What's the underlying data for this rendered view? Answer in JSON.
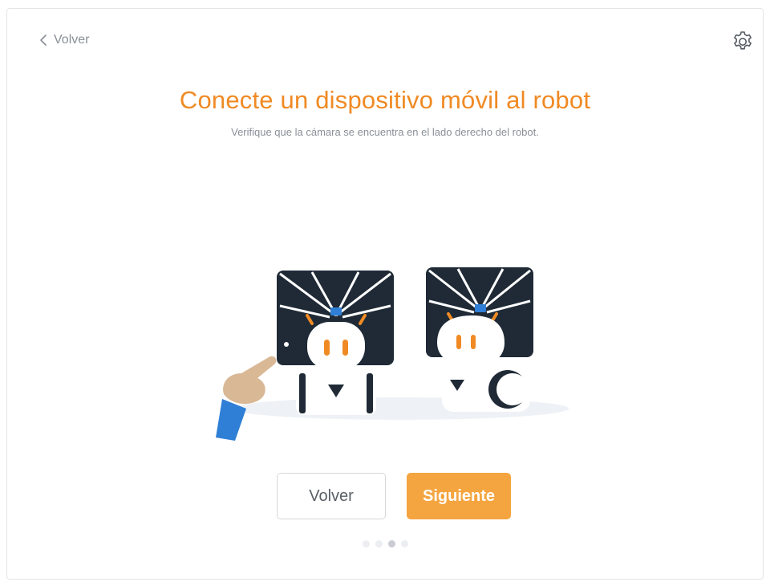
{
  "header": {
    "back_label": "Volver",
    "back_icon": "chevron-left-icon",
    "settings_icon": "gear-icon"
  },
  "content": {
    "title": "Conecte un dispositivo móvil al robot",
    "subtitle": "Verifique que la cámara se encuentra en el lado derecho del robot."
  },
  "actions": {
    "back_button": "Volver",
    "next_button": "Siguiente"
  },
  "pagination": {
    "total": 4,
    "current": 3
  },
  "colors": {
    "accent": "#f08a24",
    "button_primary": "#f5a540",
    "screen_dark": "#1f2a36",
    "robot_blue": "#2f7fd6"
  }
}
